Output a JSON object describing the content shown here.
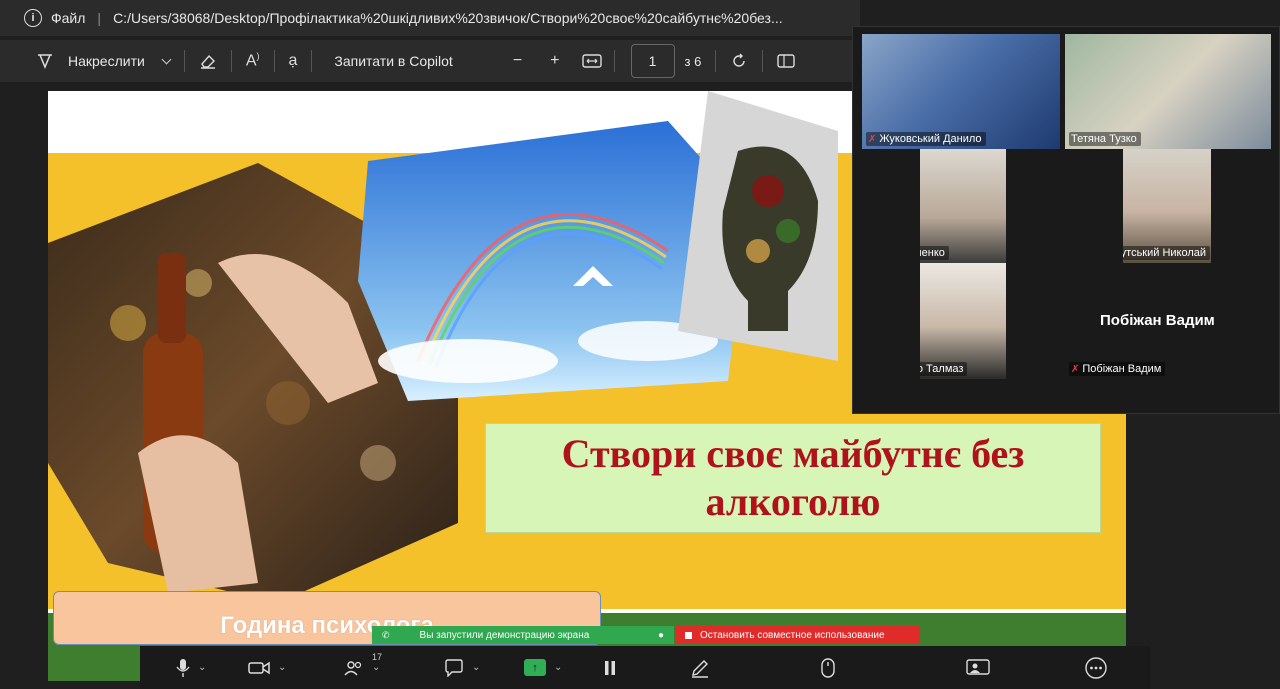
{
  "address_bar": {
    "file_label": "Файл",
    "separator": "|",
    "path": "C:/Users/38068/Desktop/Профілактика%20шкідливих%20звичок/Створи%20своє%20сайбутнє%20без..."
  },
  "toolbar": {
    "draw_label": "Накреслити",
    "copilot_label": "Запитати в Copilot",
    "minus": "−",
    "plus": "+",
    "page_current": "1",
    "page_total": "з 6"
  },
  "slide": {
    "title": "Створи своє майбутнє без алкоголю",
    "subtitle": "Година психолога"
  },
  "participants": [
    {
      "name": "Жуковський Данило",
      "muted": true
    },
    {
      "name": "Тетяна Тузко",
      "muted": false
    },
    {
      "name": "Лев Ляшенко",
      "muted": true
    },
    {
      "name": "Краснокутський Николай",
      "muted": true
    },
    {
      "name": "Михайло Талмаз",
      "muted": true
    },
    {
      "name": "Побіжан Вадим",
      "muted": true
    }
  ],
  "participant_placeholder_name": "Побіжан Вадим",
  "share_bar": {
    "status": "Вы запустили демонстрацию экрана",
    "stop": "Остановить совместное использование"
  },
  "controls": {
    "participants_count": "17"
  },
  "colors": {
    "slide_yellow": "#f4c12a",
    "slide_green": "#3f7d2f",
    "title_red": "#b0121b",
    "share_green": "#2fa84f",
    "share_red": "#e02b2b"
  }
}
